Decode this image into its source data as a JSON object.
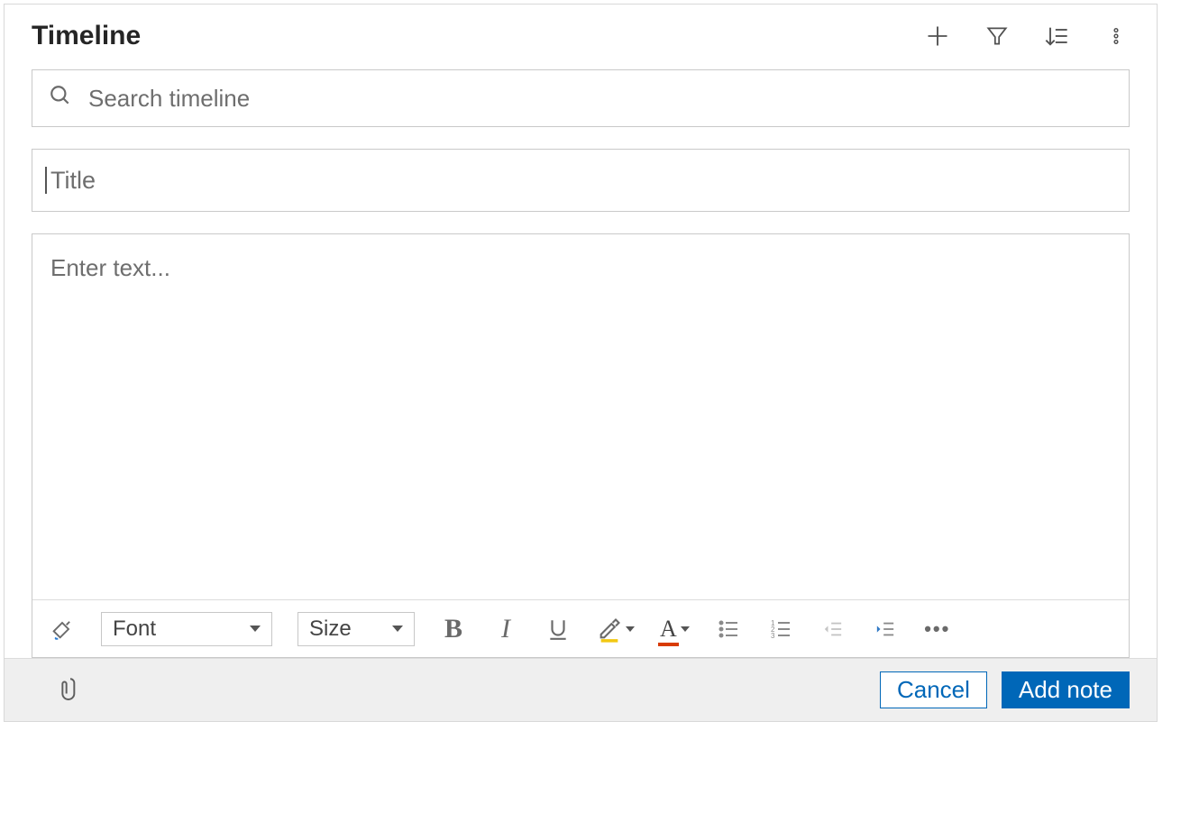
{
  "heading": "Timeline",
  "search": {
    "placeholder": "Search timeline",
    "value": ""
  },
  "title_input": {
    "placeholder": "Title",
    "value": ""
  },
  "body_input": {
    "placeholder": "Enter text...",
    "value": ""
  },
  "toolbar": {
    "font_label": "Font",
    "size_label": "Size"
  },
  "footer": {
    "cancel_label": "Cancel",
    "submit_label": "Add note"
  }
}
